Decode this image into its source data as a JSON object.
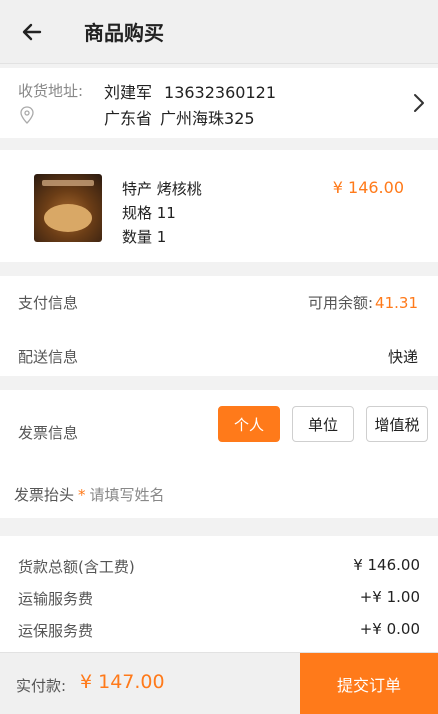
{
  "header": {
    "title": "商品购买",
    "back_icon": "arrow-left-icon"
  },
  "address": {
    "label": "收货地址:",
    "name": "刘建军",
    "phone": "13632360121",
    "province": "广东省",
    "detail": "广州海珠325"
  },
  "product": {
    "name": "特产 烤核桃",
    "spec": "规格 11",
    "qty": "数量 1",
    "price": "¥ 146.00"
  },
  "payment": {
    "label": "支付信息",
    "balance_label": "可用余额:",
    "balance_value": "41.31",
    "shipping_label": "配送信息",
    "shipping_value": "快递"
  },
  "invoice": {
    "label": "发票信息",
    "options": [
      "个人",
      "单位",
      "增值税"
    ],
    "selected": "个人",
    "header_label": "发票抬头",
    "header_required": "*",
    "header_placeholder": "请填写姓名"
  },
  "fees": {
    "goods_label": "货款总额(含工费)",
    "goods_value": "¥ 146.00",
    "transport_label": "运输服务费",
    "transport_value": "+¥ 1.00",
    "insurance_label": "运保服务费",
    "insurance_value": "+¥ 0.00"
  },
  "footer": {
    "paid_label": "实付款:",
    "total": "¥ 147.00",
    "submit_label": "提交订单"
  },
  "colors": {
    "accent": "#ff7a1a",
    "background": "#f2f2f2"
  }
}
